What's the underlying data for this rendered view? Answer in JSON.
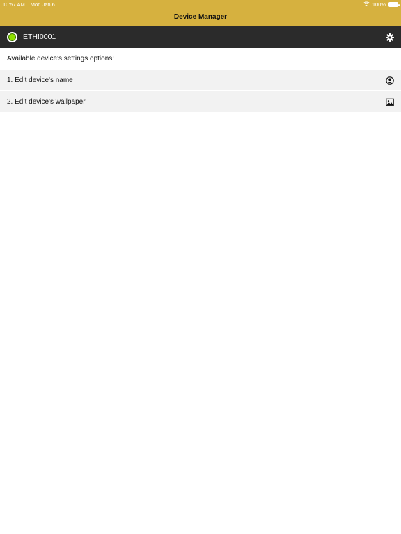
{
  "status_bar": {
    "time": "10:57 AM",
    "date": "Mon Jan 6",
    "battery": "100%"
  },
  "nav": {
    "title": "Device Manager"
  },
  "device": {
    "name": "ETH!0001",
    "status_color": "#8ee000"
  },
  "content": {
    "intro": "Available device's settings options:",
    "options": [
      {
        "label": "1. Edit device's name",
        "icon": "person-circle-icon"
      },
      {
        "label": "2. Edit device's wallpaper",
        "icon": "image-icon"
      }
    ]
  },
  "colors": {
    "accent": "#d6b13f",
    "device_bar": "#2b2b2b",
    "row_background": "#f2f2f2"
  }
}
